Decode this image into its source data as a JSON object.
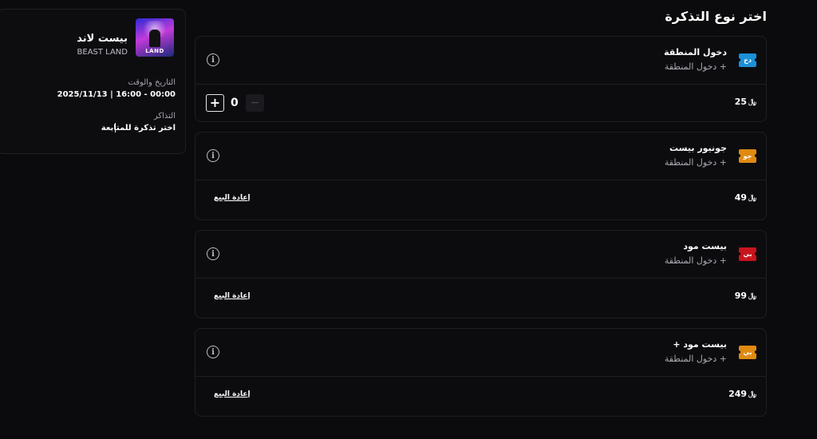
{
  "event": {
    "name_ar": "بيست لاند",
    "name_en": "BEAST LAND",
    "thumb_text": "LAND",
    "datetime_label": "التاريخ والوقت",
    "datetime_value": "2025/11/13 | 16:00 - 00:00",
    "tickets_label": "التذاكر",
    "tickets_value": "اختر تذكرة للمتابعة"
  },
  "page_title": "اختر نوع التذكرة",
  "info_glyph": "i",
  "currency_symbol": "﷼",
  "tickets": [
    {
      "name": "دخول المنطقة",
      "subtitle": "+ دخول المنطقة",
      "badge": "دخ",
      "badge_color": "#1c8fd6",
      "price": "25",
      "mode": "quantity",
      "quantity": "0",
      "plus": "+",
      "minus": "−"
    },
    {
      "name": "جونيور بيست",
      "subtitle": "+ دخول المنطقة",
      "badge": "جو",
      "badge_color": "#e08a12",
      "price": "49",
      "mode": "resale",
      "resale_label": "إعادة البيع"
    },
    {
      "name": "بيست مود",
      "subtitle": "+ دخول المنطقة",
      "badge": "بي",
      "badge_color": "#c8141c",
      "price": "99",
      "mode": "resale",
      "resale_label": "إعادة البيع"
    },
    {
      "name": "بيست مود +",
      "subtitle": "+ دخول المنطقة",
      "badge": "بي",
      "badge_color": "#e08a12",
      "price": "249",
      "mode": "resale",
      "resale_label": "إعادة البيع"
    }
  ]
}
